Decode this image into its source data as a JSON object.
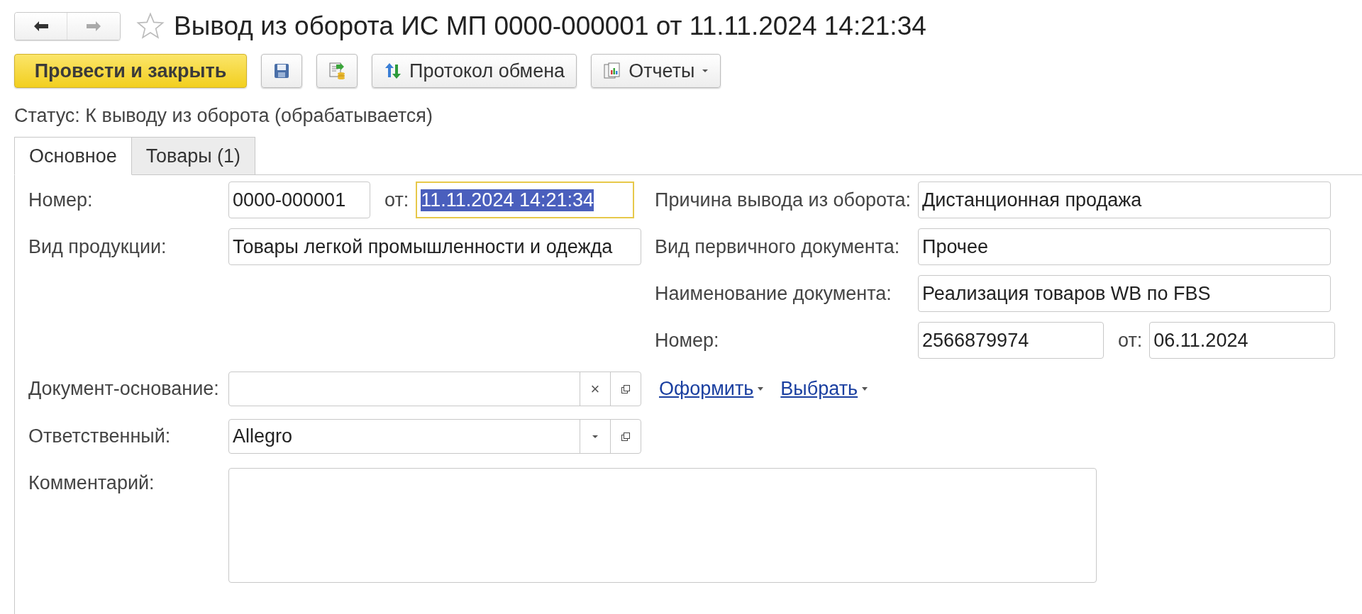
{
  "nav": {
    "back_enabled": true,
    "forward_enabled": false
  },
  "favorite": false,
  "title": "Вывод из оборота ИС МП 0000-000001 от 11.11.2024 14:21:34",
  "toolbar": {
    "primary_button": "Провести и закрыть",
    "buttons": [
      {
        "kind": "save"
      },
      {
        "kind": "post"
      },
      {
        "kind": "protocol",
        "label": "Протокол обмена"
      },
      {
        "kind": "reports",
        "label": "Отчеты",
        "dropdown": true
      }
    ]
  },
  "status": "Статус: К выводу из оборота (обрабатывается)",
  "tabs": [
    {
      "label": "Основное",
      "selected": true
    },
    {
      "label": "Товары (1)",
      "selected": false
    }
  ],
  "number": {
    "label": "Номер:",
    "value": "0000-000001",
    "date_label": "от:",
    "date": "11.11.2024 14:21:34",
    "focused": true,
    "text_selected": true
  },
  "product_type": {
    "label": "Вид продукции:",
    "value": "Товары легкой промышленности и одежда"
  },
  "right_fields": [
    {
      "label": "Причина вывода из оборота:",
      "value": "Дистанционная продажа"
    },
    {
      "label": "Вид первичного документа:",
      "value": "Прочее"
    },
    {
      "label": "Наименование документа:",
      "value": "Реализация товаров WB по FBS"
    }
  ],
  "primary_doc_number": {
    "label": "Номер:",
    "value": "2566879974",
    "date_label": "от:",
    "date": "06.11.2024"
  },
  "basis_document": {
    "label": "Документ-основание:",
    "clear_glyph": "×",
    "links": [
      "Оформить",
      "Выбрать"
    ]
  },
  "responsible": {
    "label": "Ответственный:",
    "value": "Allegro"
  },
  "comment": {
    "label": "Комментарий:"
  }
}
